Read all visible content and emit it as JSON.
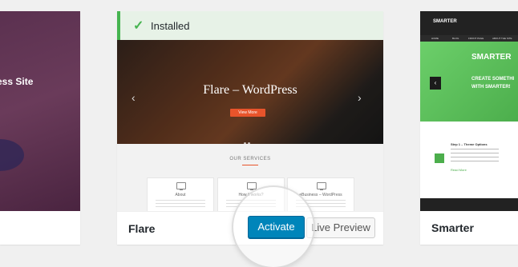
{
  "left_theme": {
    "screenshot_title": "ess Site"
  },
  "center_theme": {
    "notice": {
      "label": "Installed"
    },
    "screenshot": {
      "headline": "Flare – WordPress",
      "cta": "View More",
      "services_heading": "OUR SERVICES",
      "services": [
        "About",
        "How it works?",
        "eBusiness – WordPress"
      ]
    },
    "name": "Flare",
    "actions": {
      "activate": "Activate",
      "live_preview": "Live Preview"
    }
  },
  "right_theme": {
    "screenshot": {
      "brand": "SMARTER",
      "nav": [
        "HOME",
        "BLOG",
        "FRONT PAGE",
        "ABOUT THE SITE"
      ],
      "hero_title": "SMARTER",
      "hero_line1": "CREATE SOMETHI",
      "hero_line2": "WITH SMARTER!",
      "step_title": "Step 1 – Theme Options",
      "read_more": "Read More"
    },
    "name": "Smarter"
  },
  "colors": {
    "primary_button": "#0085ba",
    "installed_green": "#46b450",
    "accent_orange": "#e8542b"
  }
}
